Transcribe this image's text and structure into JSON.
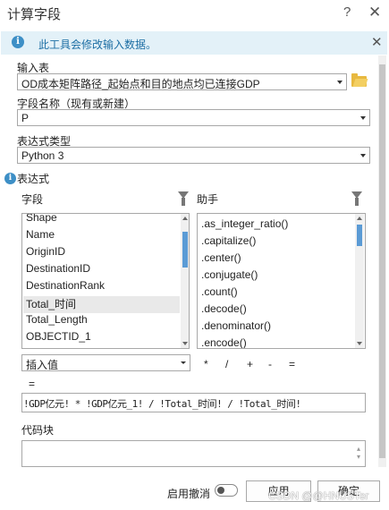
{
  "window": {
    "title": "计算字段",
    "help": "?",
    "close": "✕"
  },
  "info": {
    "text": "此工具会修改输入数据。",
    "icon": "info-icon",
    "close": "✕"
  },
  "input_table": {
    "label": "输入表",
    "value": "OD成本矩阵路径_起始点和目的地点均已连接GDP",
    "icon": "folder-icon"
  },
  "field_name": {
    "label": "字段名称（现有或新建）",
    "value": "P"
  },
  "expr_type": {
    "label": "表达式类型",
    "value": "Python 3"
  },
  "expression": {
    "label": "表达式",
    "fields_label": "字段",
    "helpers_label": "助手",
    "fields": [
      "Shape",
      "Name",
      "OriginID",
      "DestinationID",
      "DestinationRank",
      "Total_时间",
      "Total_Length",
      "OBJECTID_1"
    ],
    "selected_field": "Total_时间",
    "helpers": [
      ".as_integer_ratio()",
      ".capitalize()",
      ".center()",
      ".conjugate()",
      ".count()",
      ".decode()",
      ".denominator()",
      ".encode()"
    ],
    "insert_value": "插入值",
    "operators": [
      "*",
      "/",
      "+",
      "-",
      "="
    ],
    "prefix": "=",
    "text": "!GDP亿元! * !GDP亿元_1! / !Total_时间! / !Total_时间!"
  },
  "code_block": {
    "label": "代码块",
    "value": ""
  },
  "footer": {
    "undo_label": "启用撤消",
    "apply": "应用",
    "ok": "确定",
    "watermark": "CSDN @@HNUSTer"
  },
  "colors": {
    "info_bg": "#e3f1f8",
    "info_text": "#1c6ea4",
    "accent": "#5b9bd5",
    "selected_row": "#e9e9e9"
  }
}
